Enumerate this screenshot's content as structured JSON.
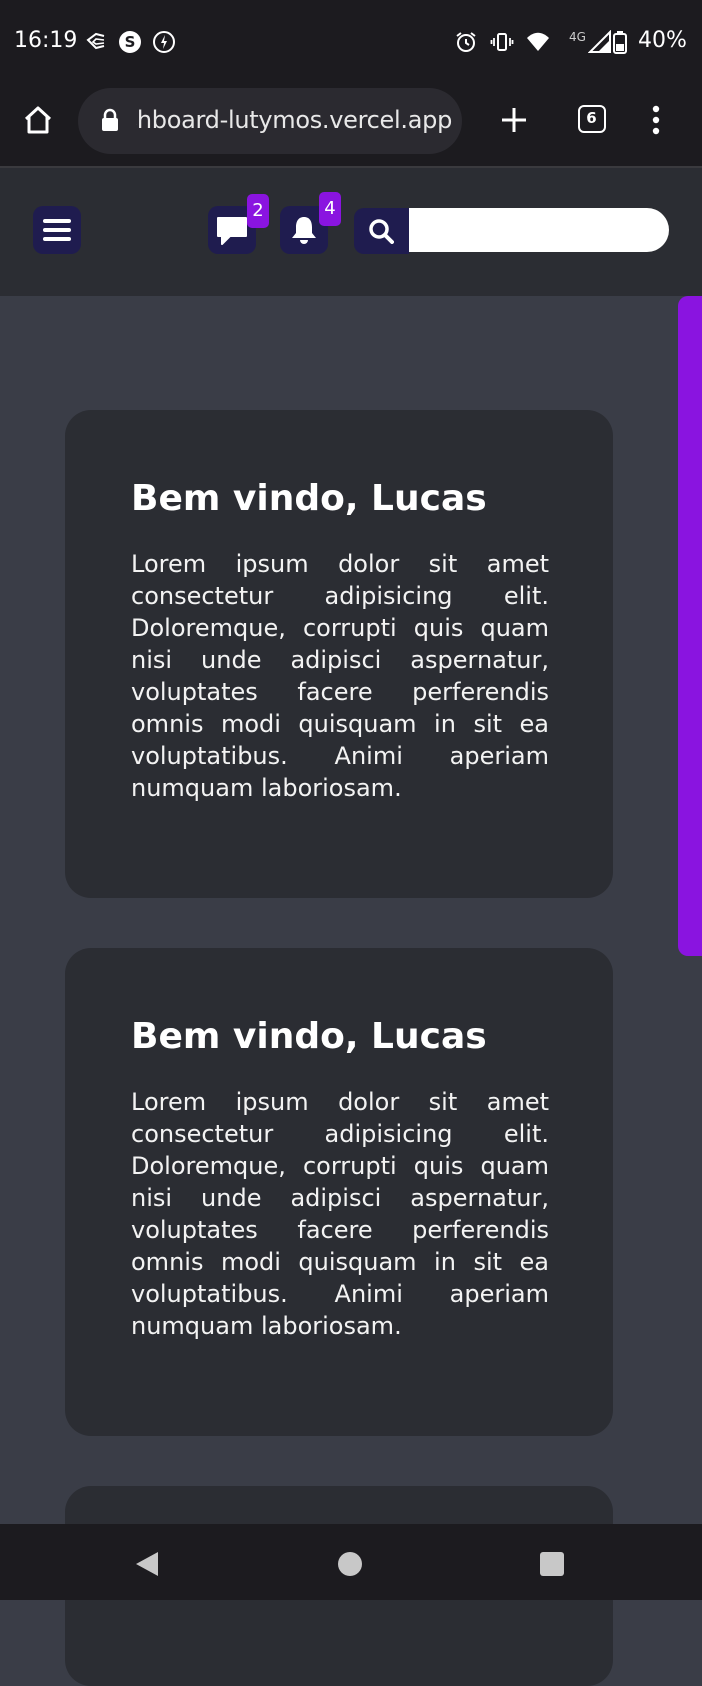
{
  "status_bar": {
    "time": "16:19",
    "network": "4G",
    "battery": "40%",
    "icons": [
      "email-sync-icon",
      "shazam-icon",
      "sync-icon",
      "alarm-icon",
      "vibrate-icon",
      "wifi-icon",
      "signal-icon",
      "battery-icon"
    ]
  },
  "browser": {
    "url": "shboard-lutymos.vercel.app",
    "tab_count": "6"
  },
  "header": {
    "messages_count": "2",
    "notifications_count": "4",
    "search_value": "",
    "accent_color": "#8a14e0",
    "icon_bg_color": "#1f1c4f"
  },
  "cards": [
    {
      "title": "Bem vindo, Lucas",
      "body": "Lorem ipsum dolor sit amet consectetur adipisicing elit. Doloremque, corrupti quis quam nisi unde adipisci aspernatur, voluptates facere perferendis omnis modi quisquam in sit ea voluptatibus. Animi aperiam numquam laboriosam."
    },
    {
      "title": "Bem vindo, Lucas",
      "body": "Lorem ipsum dolor sit amet consectetur adipisicing elit. Doloremque, corrupti quis quam nisi unde adipisci aspernatur, voluptates facere perferendis omnis modi quisquam in sit ea voluptatibus. Animi aperiam numquam laboriosam."
    }
  ],
  "colors": {
    "page_bg": "#3a3d47",
    "card_bg": "#2b2d33",
    "system_bar_bg": "#1c1b1f"
  }
}
